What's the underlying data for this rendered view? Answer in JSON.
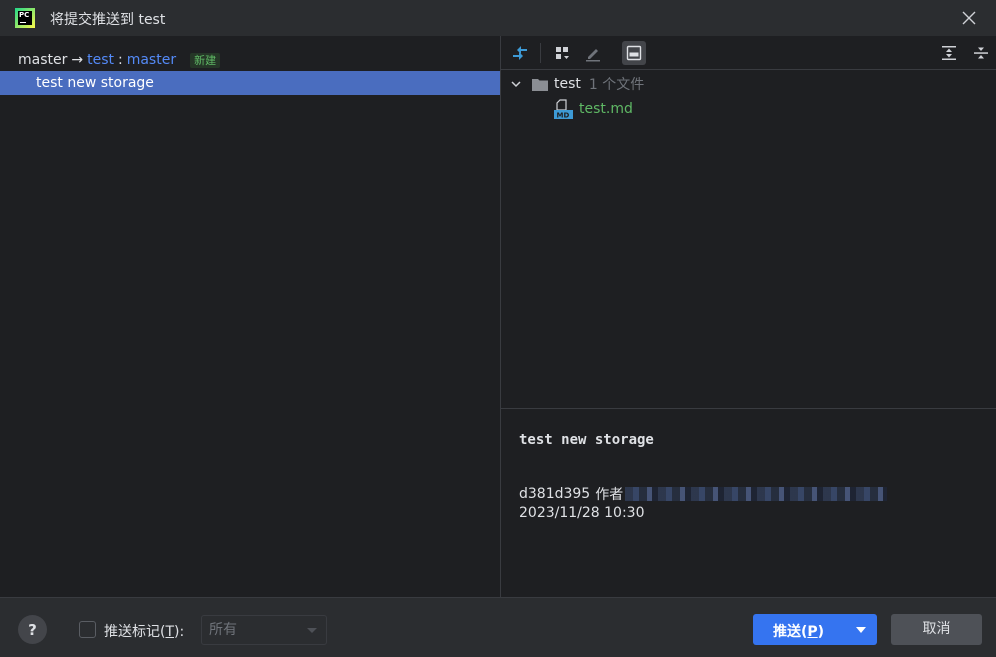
{
  "window": {
    "title": "将提交推送到 test",
    "logo_text": "PC"
  },
  "branch": {
    "source": "master",
    "arrow": "→",
    "remote": "test",
    "separator": ":",
    "target": "master",
    "badge": "新建"
  },
  "commits": [
    {
      "message": "test new storage",
      "selected": true
    }
  ],
  "file_tree": {
    "folder": {
      "name": "test",
      "count": "1 个文件"
    },
    "files": [
      {
        "name": "test.md",
        "icon": "markdown-file-icon",
        "status_color": "#5fb865"
      }
    ]
  },
  "commit_details": {
    "message": "test new storage",
    "hash": "d381d395",
    "author_label": "作者",
    "date": "2023/11/28 10:30"
  },
  "bottom": {
    "help": "?",
    "push_tags_label": "推送标记(",
    "push_tags_mnemonic": "T",
    "push_tags_suffix": "):",
    "tags_select_value": "所有",
    "push_label": "推送(",
    "push_mnemonic": "P",
    "push_suffix": ")",
    "cancel_label": "取消"
  },
  "colors": {
    "background": "#1e1f22",
    "selection": "#4a6dbf",
    "link": "#548af7",
    "new_badge": "#5fb865",
    "primary_button": "#3574f0"
  }
}
